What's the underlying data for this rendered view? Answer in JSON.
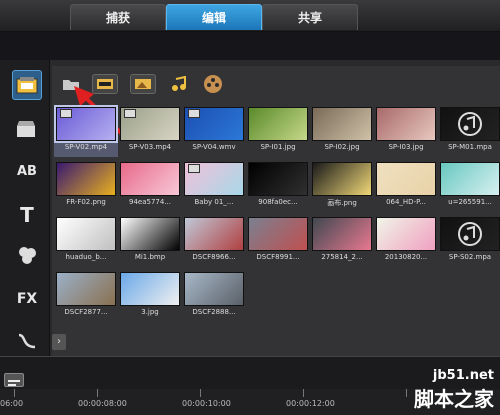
{
  "tabs": [
    {
      "label": "捕获"
    },
    {
      "label": "编辑"
    },
    {
      "label": "共享"
    }
  ],
  "library": {
    "items": [
      {
        "name": "SP-V02.mp4",
        "type": "video",
        "colors": [
          "#6a5bd6",
          "#b6b0f0"
        ],
        "selected": true
      },
      {
        "name": "SP-V03.mp4",
        "type": "video",
        "colors": [
          "#9aa08a",
          "#d8d4c4"
        ]
      },
      {
        "name": "SP-V04.wmv",
        "type": "video",
        "colors": [
          "#1b4fb0",
          "#2c78d8"
        ]
      },
      {
        "name": "SP-I01.jpg",
        "type": "image",
        "colors": [
          "#5a8a2a",
          "#c6d88a"
        ]
      },
      {
        "name": "SP-I02.jpg",
        "type": "image",
        "colors": [
          "#7a6a58",
          "#cfc2a8"
        ]
      },
      {
        "name": "SP-I03.jpg",
        "type": "image",
        "colors": [
          "#a86a6a",
          "#e8c8c0"
        ]
      },
      {
        "name": "SP-M01.mpa",
        "type": "audio",
        "colors": [
          "#111111",
          "#222222"
        ]
      },
      {
        "name": "FR-F02.png",
        "type": "frame",
        "colors": [
          "#3a1a70",
          "#e8b020"
        ]
      },
      {
        "name": "94ea5774...",
        "type": "image",
        "colors": [
          "#e86a8a",
          "#f8c8d8"
        ]
      },
      {
        "name": "Baby 01_...",
        "type": "video",
        "colors": [
          "#f0c0d8",
          "#a8d8e8"
        ]
      },
      {
        "name": "908fa0ec...",
        "type": "image",
        "colors": [
          "#000000",
          "#303030"
        ]
      },
      {
        "name": "画布.png",
        "type": "image",
        "colors": [
          "#1a1a1a",
          "#f0d878"
        ]
      },
      {
        "name": "064_HD-P...",
        "type": "image",
        "colors": [
          "#f0e0c0",
          "#e8d2a8"
        ]
      },
      {
        "name": "u=265591...",
        "type": "image",
        "colors": [
          "#68c8c0",
          "#d8f0f0"
        ]
      },
      {
        "name": "huaduo_b...",
        "type": "image",
        "colors": [
          "#ffffff",
          "#c0c0c0"
        ]
      },
      {
        "name": "Mi1.bmp",
        "type": "image",
        "colors": [
          "#ffffff",
          "#000000"
        ]
      },
      {
        "name": "DSCF8966...",
        "type": "image",
        "colors": [
          "#c0c8d8",
          "#b04040"
        ]
      },
      {
        "name": "DSCF8991...",
        "type": "image",
        "colors": [
          "#7a8090",
          "#c05050"
        ]
      },
      {
        "name": "275814_2...",
        "type": "image",
        "colors": [
          "#404850",
          "#e87890"
        ]
      },
      {
        "name": "20130820...",
        "type": "image",
        "colors": [
          "#f0f4e8",
          "#f0a0c0"
        ]
      },
      {
        "name": "SP-S02.mpa",
        "type": "audio",
        "colors": [
          "#111111",
          "#222222"
        ]
      },
      {
        "name": "DSCF2877...",
        "type": "image",
        "colors": [
          "#9ab0c8",
          "#8a7050"
        ]
      },
      {
        "name": "3.jpg",
        "type": "image",
        "colors": [
          "#6aa8e8",
          "#f0f0f0"
        ]
      },
      {
        "name": "DSCF2888...",
        "type": "image",
        "colors": [
          "#a8b8c8",
          "#5a6068"
        ]
      }
    ]
  },
  "timeline": {
    "times": [
      "06:00",
      "00:00:08:00",
      "00:00:10:00",
      "00:00:12:00"
    ]
  },
  "watermark": {
    "domain": "jb51.net",
    "name": "脚本之家"
  },
  "colors": {
    "accent": "#2a8fd6",
    "arrow": "#e02020"
  }
}
